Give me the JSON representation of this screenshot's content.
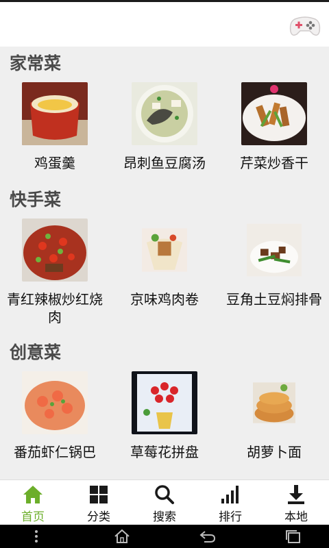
{
  "sections": [
    {
      "title": "家常菜",
      "items": [
        {
          "name": "鸡蛋羹"
        },
        {
          "name": "昂刺鱼豆腐汤"
        },
        {
          "name": "芹菜炒香干"
        }
      ]
    },
    {
      "title": "快手菜",
      "items": [
        {
          "name": "青红辣椒炒红烧肉"
        },
        {
          "name": "京味鸡肉卷"
        },
        {
          "name": "豆角土豆焖排骨"
        }
      ]
    },
    {
      "title": "创意菜",
      "items": [
        {
          "name": "番茄虾仁锅巴"
        },
        {
          "name": "草莓花拼盘"
        },
        {
          "name": "胡萝卜面"
        }
      ]
    }
  ],
  "nav": {
    "tabs": [
      {
        "label": "首页",
        "icon": "home-icon"
      },
      {
        "label": "分类",
        "icon": "grid-icon"
      },
      {
        "label": "搜索",
        "icon": "search-icon"
      },
      {
        "label": "排行",
        "icon": "signal-bars-icon"
      },
      {
        "label": "本地",
        "icon": "download-icon"
      }
    ],
    "active_index": 0
  },
  "colors": {
    "accent": "#6cae2a",
    "content_bg": "#efefef",
    "section_title": "#4a4a4a"
  }
}
